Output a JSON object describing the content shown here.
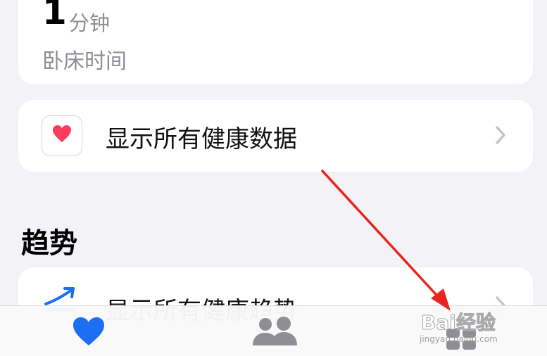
{
  "sleep_card": {
    "value": "1",
    "unit": "分钟",
    "label": "卧床时间"
  },
  "all_data_row": {
    "label": "显示所有健康数据",
    "icon": "health-heart-icon"
  },
  "trends": {
    "title": "趋势",
    "row_label": "显示所有健康趋势",
    "icon": "trend-arrow-icon"
  },
  "tabbar": {
    "tabs": [
      {
        "icon": "heart-icon",
        "active": true
      },
      {
        "icon": "people-icon",
        "active": false
      },
      {
        "icon": "grid-icon",
        "active": false
      }
    ]
  },
  "colors": {
    "accent": "#1c6ef2",
    "inactive": "#8e8e93",
    "heart": "#ff3b5c",
    "annotation_arrow": "#e8251f"
  },
  "watermark": {
    "logo": "Bai经验",
    "sub": "jingyan.baidu.com"
  }
}
